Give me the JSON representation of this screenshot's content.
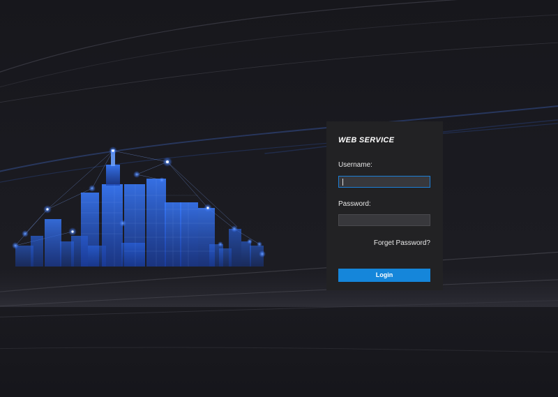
{
  "panel": {
    "title": "WEB SERVICE",
    "username_label": "Username:",
    "username_value": "",
    "password_label": "Password:",
    "password_value": "",
    "forget_password": "Forget Password?",
    "login_button": "Login"
  },
  "colors": {
    "accent": "#1586da",
    "panel_bg": "#222224",
    "page_bg": "#17171c",
    "city_glow": "#2f6cff"
  },
  "background": {
    "illustration": "glowing-blue-wireframe-city-skyline"
  }
}
